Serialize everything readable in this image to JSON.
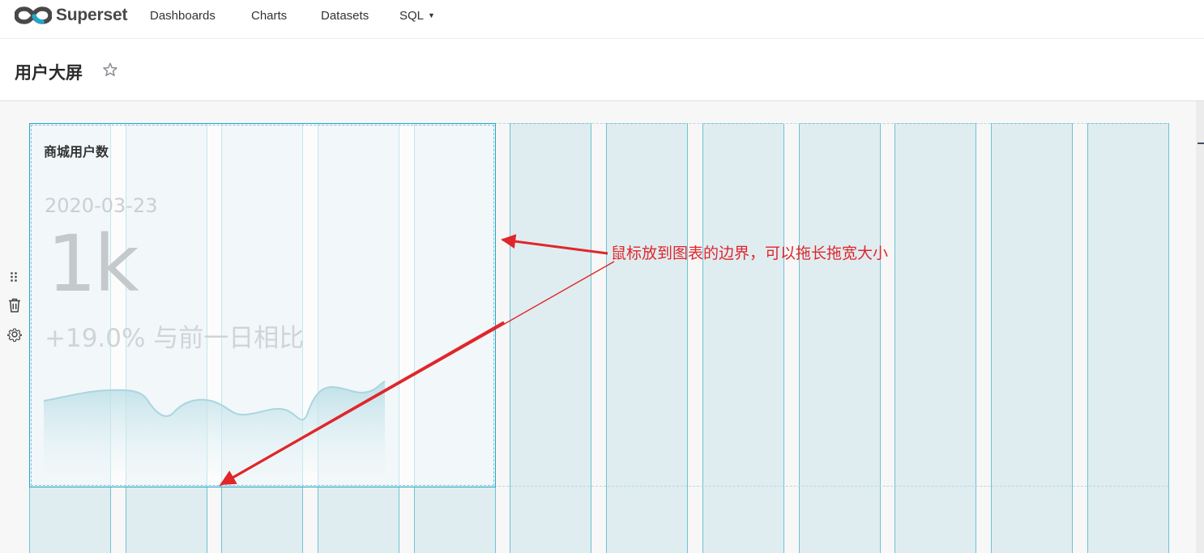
{
  "app": {
    "name": "Superset"
  },
  "nav": {
    "items": [
      "Dashboards",
      "Charts",
      "Datasets"
    ],
    "sql_menu": "SQL"
  },
  "dashboard": {
    "title": "用户大屏"
  },
  "chart": {
    "title": "商城用户数",
    "big_number": {
      "date": "2020-03-23",
      "value": "1k",
      "comparison": "+19.0% 与前一日相比"
    }
  },
  "annotation": {
    "text": "鼠标放到图表的边界，可以拖长拖宽大小"
  },
  "colors": {
    "accent": "#20a7c9",
    "annotation": "#e0262b",
    "column_fill": "#dfedf1",
    "column_border": "#6ec3d4"
  },
  "icons": [
    "superset-logo-icon",
    "star-icon",
    "drag-handle-icon",
    "trash-icon",
    "gear-icon",
    "chevron-down-icon"
  ]
}
